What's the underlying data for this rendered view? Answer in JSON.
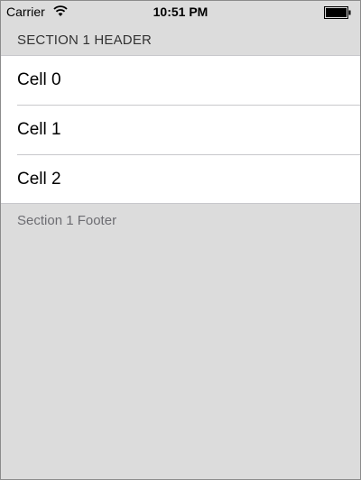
{
  "status_bar": {
    "carrier": "Carrier",
    "time": "10:51 PM",
    "wifi_icon": "wifi-icon",
    "battery_icon": "battery-icon"
  },
  "table": {
    "section_header": "SECTION 1 HEADER",
    "cells": [
      {
        "label": "Cell 0"
      },
      {
        "label": "Cell 1"
      },
      {
        "label": "Cell 2"
      }
    ],
    "section_footer": "Section 1 Footer"
  },
  "colors": {
    "background": "#dcdcdc",
    "cell_background": "#ffffff",
    "separator": "#c8c8cc",
    "footer_text": "#6d6d72"
  }
}
